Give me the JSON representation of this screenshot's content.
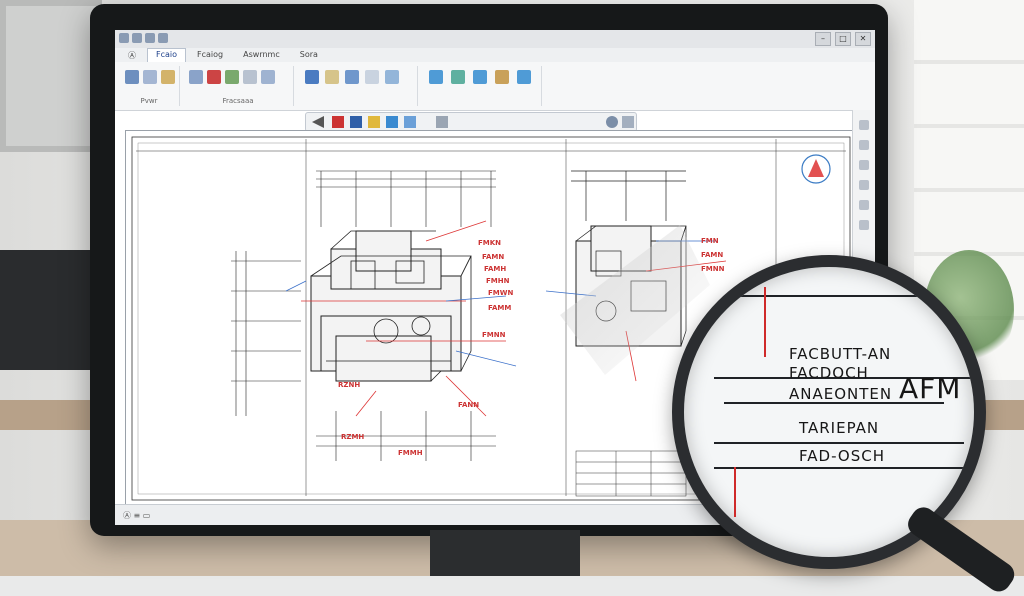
{
  "window": {
    "title": "",
    "tabs": [
      "Ⓐ",
      "Fcaio",
      "Fcaiog",
      "Aswrnmc",
      "Sora"
    ],
    "active_tab": 1,
    "controls": [
      "–",
      "□",
      "✕"
    ]
  },
  "ribbon": {
    "groups": [
      {
        "label": "Pvwr"
      },
      {
        "label": "Fracsaaa"
      }
    ]
  },
  "cmdbar": {
    "search_placeholder": ""
  },
  "status": {
    "left": "Ⓐ ≡ ▭"
  },
  "drawing": {
    "front_view_labels": [
      "FMKN",
      "FAMN",
      "FAMH",
      "FMHN",
      "FMWN",
      "FAMM",
      "FMNN",
      "FANN"
    ],
    "bottom_labels": [
      "RZNH",
      "RZMH",
      "FMMH"
    ],
    "right_labels": [
      "FMN",
      "FAMN",
      "FMNN"
    ]
  },
  "magnifier": {
    "lines": [
      "FACBUTT-AN",
      "FACDOCH",
      "ANAEONTEN",
      "AFM",
      "TARIEPAN",
      "FAD-OSCH"
    ]
  },
  "colors": {
    "accent": "#cf2a2a",
    "line": "#222222",
    "blue": "#3a6fc9"
  }
}
